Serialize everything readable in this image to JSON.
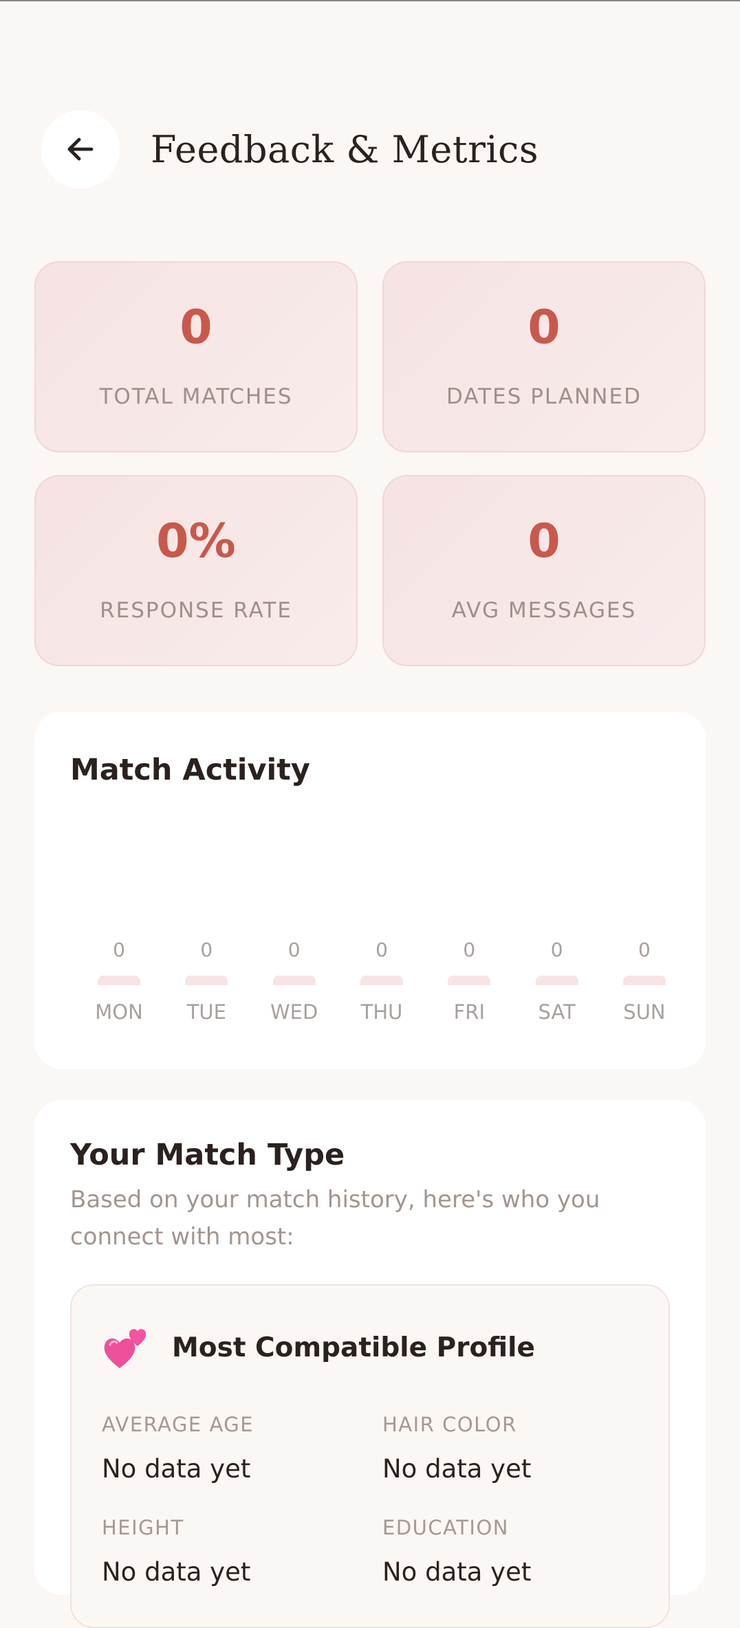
{
  "header": {
    "title": "Feedback & Metrics"
  },
  "stats": [
    {
      "value": "0",
      "label": "TOTAL MATCHES"
    },
    {
      "value": "0",
      "label": "DATES PLANNED"
    },
    {
      "value": "0%",
      "label": "RESPONSE RATE"
    },
    {
      "value": "0",
      "label": "AVG MESSAGES"
    }
  ],
  "activity": {
    "title": "Match Activity",
    "days": [
      {
        "label": "MON",
        "count": "0"
      },
      {
        "label": "TUE",
        "count": "0"
      },
      {
        "label": "WED",
        "count": "0"
      },
      {
        "label": "THU",
        "count": "0"
      },
      {
        "label": "FRI",
        "count": "0"
      },
      {
        "label": "SAT",
        "count": "0"
      },
      {
        "label": "SUN",
        "count": "0"
      }
    ]
  },
  "match_type": {
    "title": "Your Match Type",
    "subtitle": "Based on your match history, here's who you connect with most:",
    "profile": {
      "title": "Most Compatible Profile",
      "icon": "two-hearts-icon",
      "fields": [
        {
          "label": "AVERAGE AGE",
          "value": "No data yet"
        },
        {
          "label": "HAIR COLOR",
          "value": "No data yet"
        },
        {
          "label": "HEIGHT",
          "value": "No data yet"
        },
        {
          "label": "EDUCATION",
          "value": "No data yet"
        }
      ]
    }
  },
  "colors": {
    "background": "#fbf7f5",
    "accent": "#c9584c",
    "stat_card": "#f6e3e3",
    "muted_text": "#a08e8a"
  }
}
